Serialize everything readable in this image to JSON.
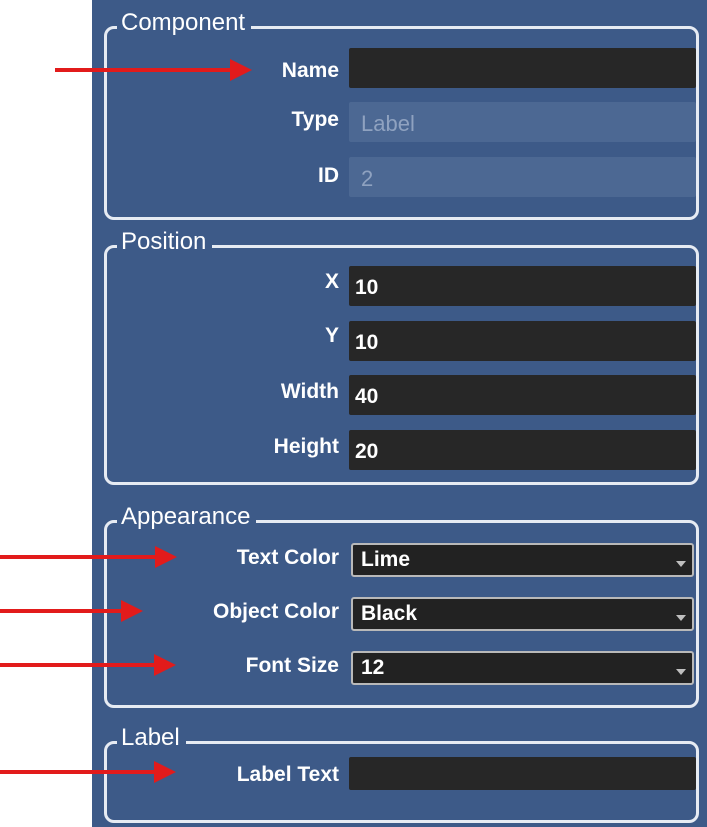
{
  "component": {
    "legend": "Component",
    "name_label": "Name",
    "name_value": "",
    "type_label": "Type",
    "type_value": "Label",
    "id_label": "ID",
    "id_value": "2"
  },
  "position": {
    "legend": "Position",
    "x_label": "X",
    "x_value": "10",
    "y_label": "Y",
    "y_value": "10",
    "width_label": "Width",
    "width_value": "40",
    "height_label": "Height",
    "height_value": "20"
  },
  "appearance": {
    "legend": "Appearance",
    "text_color_label": "Text Color",
    "text_color_value": "Lime",
    "object_color_label": "Object Color",
    "object_color_value": "Black",
    "font_size_label": "Font Size",
    "font_size_value": "12"
  },
  "label": {
    "legend": "Label",
    "label_text_label": "Label Text",
    "label_text_value": ""
  },
  "colors": {
    "panel_background": "#3d5a88",
    "field_background": "#272727",
    "arrow": "#e21b1b"
  }
}
